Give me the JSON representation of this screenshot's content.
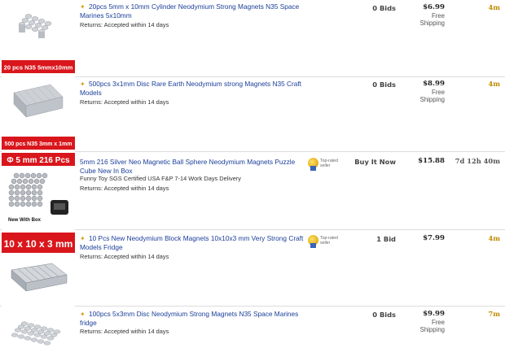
{
  "listings": [
    {
      "image_label": "20 pcs N35  5mmx10mm",
      "title": "20pcs 5mm x 10mm Cylinder Neodymium Strong Magnets N35 Space Marines 5x10mm",
      "subtitle": "",
      "returns": "Returns: Accepted within 14 days",
      "seller_badge": "",
      "bids": "0 Bids",
      "price": "$6.99",
      "shipping": "Free Shipping",
      "time_left": "4m"
    },
    {
      "image_label": "500 pcs N35 3mm x 1mm",
      "title": "500pcs 3x1mm Disc Rare Earth Neodymium strong Magnets N35 Craft Models",
      "subtitle": "",
      "returns": "Returns: Accepted within 14 days",
      "seller_badge": "",
      "bids": "0 Bids",
      "price": "$8.99",
      "shipping": "Free Shipping",
      "time_left": "4m"
    },
    {
      "image_label": "Φ 5 mm 216 Pcs",
      "image_sub_label": "New With Box",
      "title": "5mm 216 Silver Neo Magnetic Ball Sphere Neodymium Magnets Puzzle Cube New In Box",
      "subtitle": "Funny Toy SGS Certified USA F&P 7-14 Work Days Delivery",
      "returns": "Returns: Accepted within 14 days",
      "seller_badge": "Top-rated seller",
      "bids": "Buy It Now",
      "price": "$15.88",
      "shipping": "",
      "time_left": "7d 12h 40m"
    },
    {
      "image_label": "10 x 10 x 3 mm",
      "title": "10 Pcs New Neodymium Block Magnets 10x10x3 mm Very Strong Craft Models Fridge",
      "subtitle": "",
      "returns": "Returns: Accepted within 14 days",
      "seller_badge": "Top-rated seller",
      "bids": "1 Bid",
      "price": "$7.99",
      "shipping": "",
      "time_left": "4m"
    },
    {
      "image_label": "",
      "title": "100pcs 5x3mm Disc Neodymium Strong Magnets N35 Space Marines fridge",
      "subtitle": "",
      "returns": "Returns: Accepted within 14 days",
      "seller_badge": "",
      "bids": "0 Bids",
      "price": "$9.99",
      "shipping": "Free Shipping",
      "time_left": "7m"
    }
  ],
  "colors": {
    "title_link": "#1a3e99",
    "label_red": "#d9161c",
    "time_gold": "#c08a00"
  },
  "icons": [
    "new-listing-icon",
    "top-rated-seller-icon"
  ]
}
